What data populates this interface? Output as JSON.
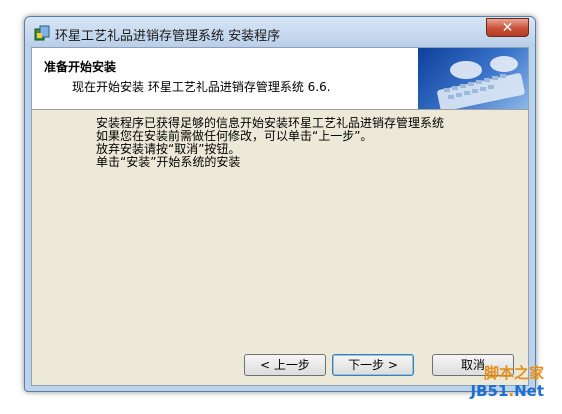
{
  "window": {
    "title": "环星工艺礼品进销存管理系统 安装程序",
    "close_glyph": "✕",
    "icon": "installer-icon"
  },
  "header": {
    "title": "准备开始安装",
    "subtitle": "现在开始安装 环星工艺礼品进销存管理系统 6.6.",
    "banner_image": "keyboard-hands-banner"
  },
  "body": {
    "lines": [
      "安装程序已获得足够的信息开始安装环星工艺礼品进销存管理系统",
      "如果您在安装前需做任何修改，可以单击“上一步”。",
      "放弃安装请按“取消”按钮。",
      "单击“安装”开始系统的安装"
    ]
  },
  "buttons": {
    "back": "< 上一步",
    "next": "下一步 >",
    "cancel": "取消"
  },
  "watermark": {
    "top": "脚本之家",
    "bottom_left": "JB51",
    "bottom_dot": ".",
    "bottom_right": "Net"
  },
  "colors": {
    "close_button": "#c7513a",
    "watermark_orange": "#e2901e",
    "watermark_blue": "#1d6fd3"
  }
}
